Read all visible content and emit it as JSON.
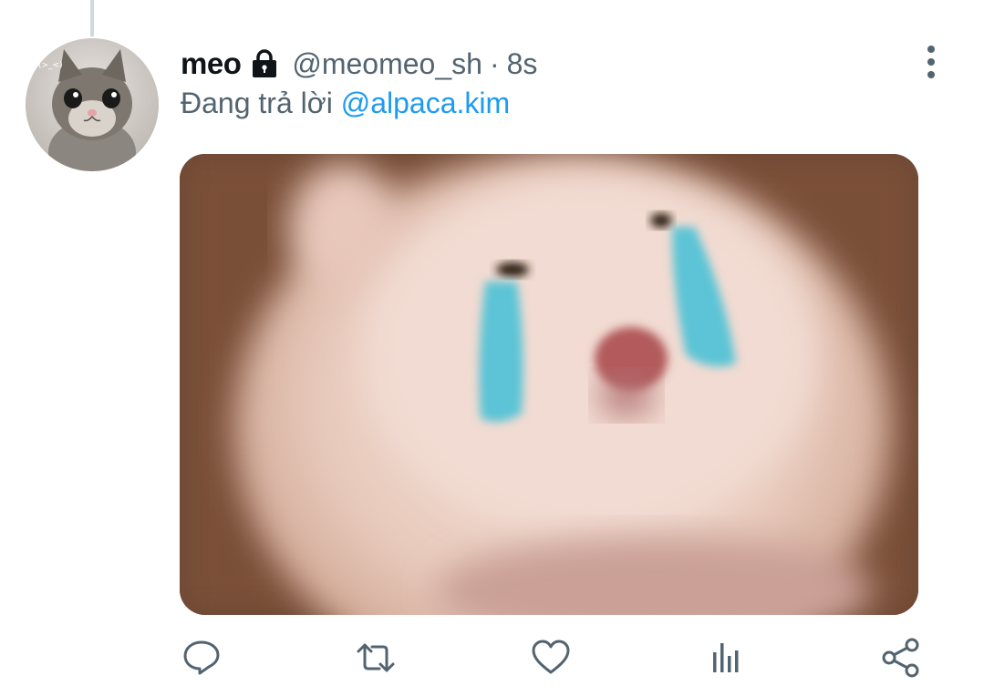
{
  "tweet": {
    "display_name": "meo",
    "handle": "@meomeo_sh",
    "separator": "·",
    "time": "8s",
    "reply_prefix": "Đang trả lời",
    "reply_to": "@alpaca.kim",
    "avatar_text": "(>_<)",
    "locked": true
  },
  "icons": {
    "lock": "lock-icon",
    "more": "more-vertical-icon",
    "reply": "reply-icon",
    "retweet": "retweet-icon",
    "like": "heart-icon",
    "stats": "bar-chart-icon",
    "share": "share-icon"
  },
  "colors": {
    "text_primary": "#0f1419",
    "text_secondary": "#536471",
    "link": "#1d9bf0",
    "icon": "#536471"
  }
}
